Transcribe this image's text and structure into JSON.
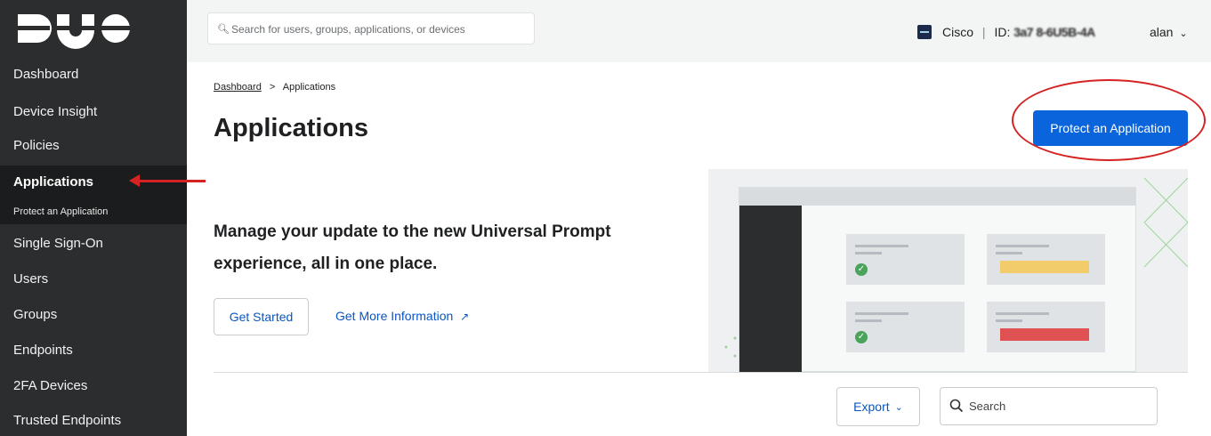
{
  "brand": {
    "logo_text": "DUO"
  },
  "sidebar": {
    "items": [
      {
        "label": "Dashboard"
      },
      {
        "label": "Device Insight"
      },
      {
        "label": "Policies"
      },
      {
        "label": "Applications"
      },
      {
        "label": "Single Sign-On"
      },
      {
        "label": "Users"
      },
      {
        "label": "Groups"
      },
      {
        "label": "Endpoints"
      },
      {
        "label": "2FA Devices"
      },
      {
        "label": "Trusted Endpoints"
      }
    ],
    "sub_item": "Protect an Application"
  },
  "header": {
    "search_placeholder": "Search for users, groups, applications, or devices",
    "org_name": "Cisco",
    "separator": "|",
    "id_label": "ID: ",
    "id_value": "3a7 8-6U5B-4A",
    "user": "alan"
  },
  "breadcrumb": {
    "root": "Dashboard",
    "sep": ">",
    "current": "Applications"
  },
  "page": {
    "title": "Applications",
    "primary_button": "Protect an Application"
  },
  "banner": {
    "heading": "Manage your update to the new Universal Prompt experience, all in one place.",
    "get_started": "Get Started",
    "more_info": "Get More Information"
  },
  "table_controls": {
    "export": "Export",
    "search_placeholder": "Search"
  },
  "colors": {
    "accent": "#0a65dd",
    "sidebar_bg": "#2b2d2f",
    "annotation_red": "#d52222"
  }
}
